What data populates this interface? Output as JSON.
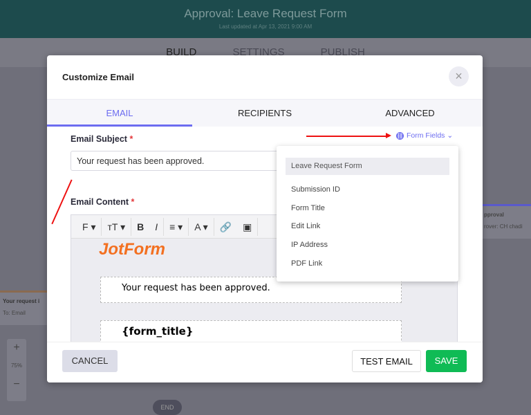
{
  "header": {
    "title": "Approval: Leave Request Form",
    "subtitle": "Last updated at Apr 13, 2021 9:00 AM"
  },
  "nav": [
    "BUILD",
    "SETTINGS",
    "PUBLISH"
  ],
  "canvas": {
    "left_node": "Your request i",
    "left_to": "To:",
    "left_email": "Email",
    "right_node": "pproval",
    "right_approver": "rover:",
    "right_initials": "CH",
    "right_name": "chadi",
    "zoom": "75%",
    "plus": "+",
    "minus": "−",
    "end": "END"
  },
  "modal": {
    "title": "Customize Email",
    "close": "×",
    "tabs": [
      "EMAIL",
      "RECIPIENTS",
      "ADVANCED"
    ],
    "subject_label": "Email Subject",
    "required": "*",
    "subject_value": "Your request has been approved.",
    "form_fields": "Form Fields ⌄",
    "content_label": "Email Content",
    "toolbar": [
      "F ▾",
      "тT ▾",
      "B",
      "I",
      "≡ ▾",
      "A ▾",
      "🔗",
      "▣"
    ],
    "logo": "JotForm",
    "content_line1": "Your request has been approved.",
    "content_line2": "{form_title}",
    "cancel": "CANCEL",
    "test_email": "TEST EMAIL",
    "save": "SAVE"
  },
  "dropdown": {
    "header": "Leave Request Form",
    "items": [
      "Submission ID",
      "Form Title",
      "Edit Link",
      "IP Address",
      "PDF Link"
    ]
  }
}
